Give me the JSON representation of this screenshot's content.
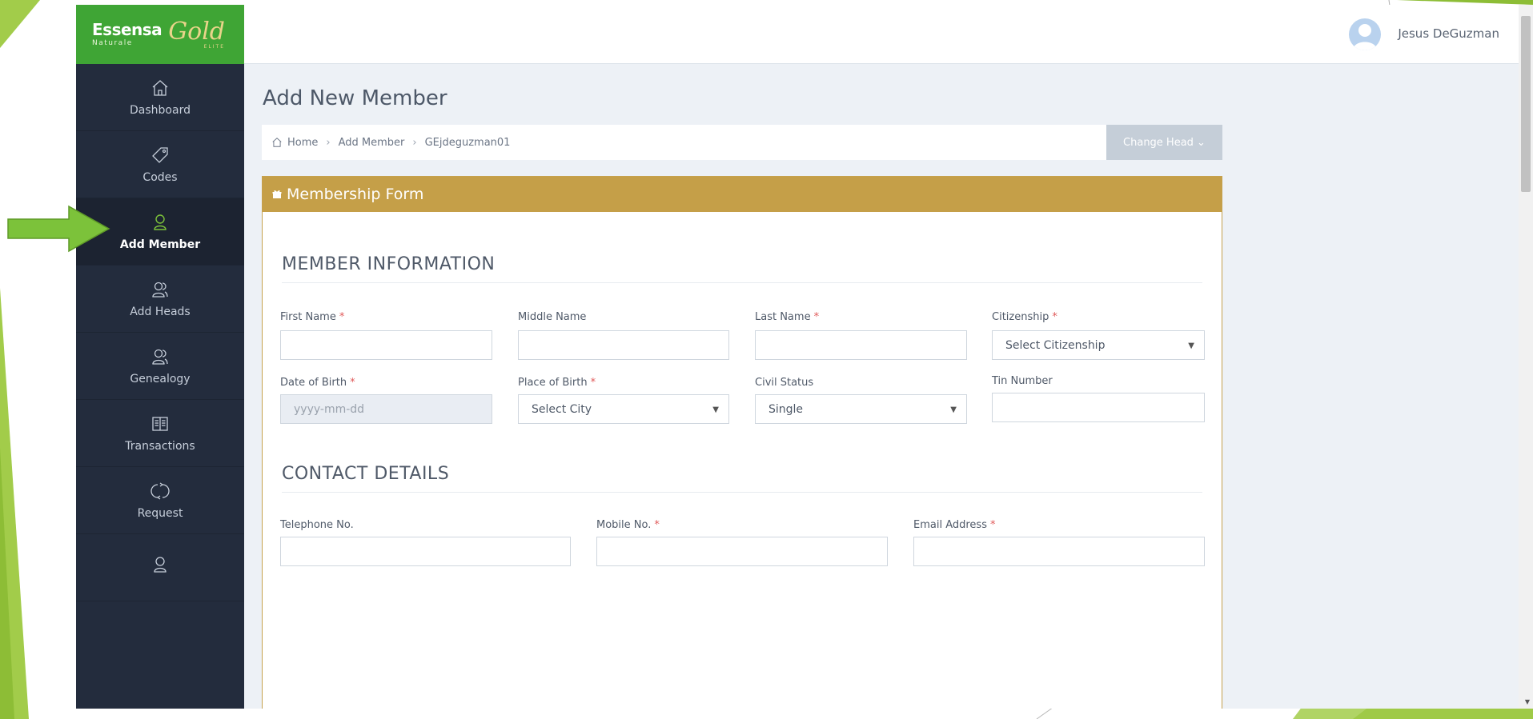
{
  "logo": {
    "brand": "Essensa",
    "sub": "Naturale",
    "gold": "Gold",
    "elite": "ELITE"
  },
  "sidebar": {
    "items": [
      {
        "label": "Dashboard",
        "icon": "home-icon",
        "active": false
      },
      {
        "label": "Codes",
        "icon": "tag-icon",
        "active": false
      },
      {
        "label": "Add Member",
        "icon": "user-icon",
        "active": true
      },
      {
        "label": "Add Heads",
        "icon": "users-icon",
        "active": false
      },
      {
        "label": "Genealogy",
        "icon": "users-icon",
        "active": false
      },
      {
        "label": "Transactions",
        "icon": "book-icon",
        "active": false
      },
      {
        "label": "Request",
        "icon": "refresh-icon",
        "active": false
      },
      {
        "label": "",
        "icon": "user-icon",
        "active": false
      }
    ]
  },
  "header": {
    "user_name": "Jesus DeGuzman"
  },
  "page": {
    "title": "Add New Member"
  },
  "breadcrumb": {
    "home": "Home",
    "section": "Add Member",
    "current": "GEjdeguzman01",
    "change_head_label": "Change Head ⌄"
  },
  "form": {
    "card_title": "Membership Form",
    "member_section": "MEMBER INFORMATION",
    "contact_section": "CONTACT DETAILS",
    "first_name_label": "First Name",
    "middle_name_label": "Middle Name",
    "last_name_label": "Last Name",
    "citizenship_label": "Citizenship",
    "citizenship_value": "Select Citizenship",
    "dob_label": "Date of Birth",
    "dob_placeholder": "yyyy-mm-dd",
    "pob_label": "Place of Birth",
    "pob_value": "Select City",
    "civil_status_label": "Civil Status",
    "civil_status_value": "Single",
    "tin_label": "Tin Number",
    "telephone_label": "Telephone No.",
    "mobile_label": "Mobile No.",
    "email_label": "Email Address",
    "required_mark": "*"
  },
  "colors": {
    "sidebar": "#232c3d",
    "logo_bg": "#3fa535",
    "card_header": "#c59f48",
    "arrow": "#7cc23a",
    "required": "#e05a5a"
  }
}
